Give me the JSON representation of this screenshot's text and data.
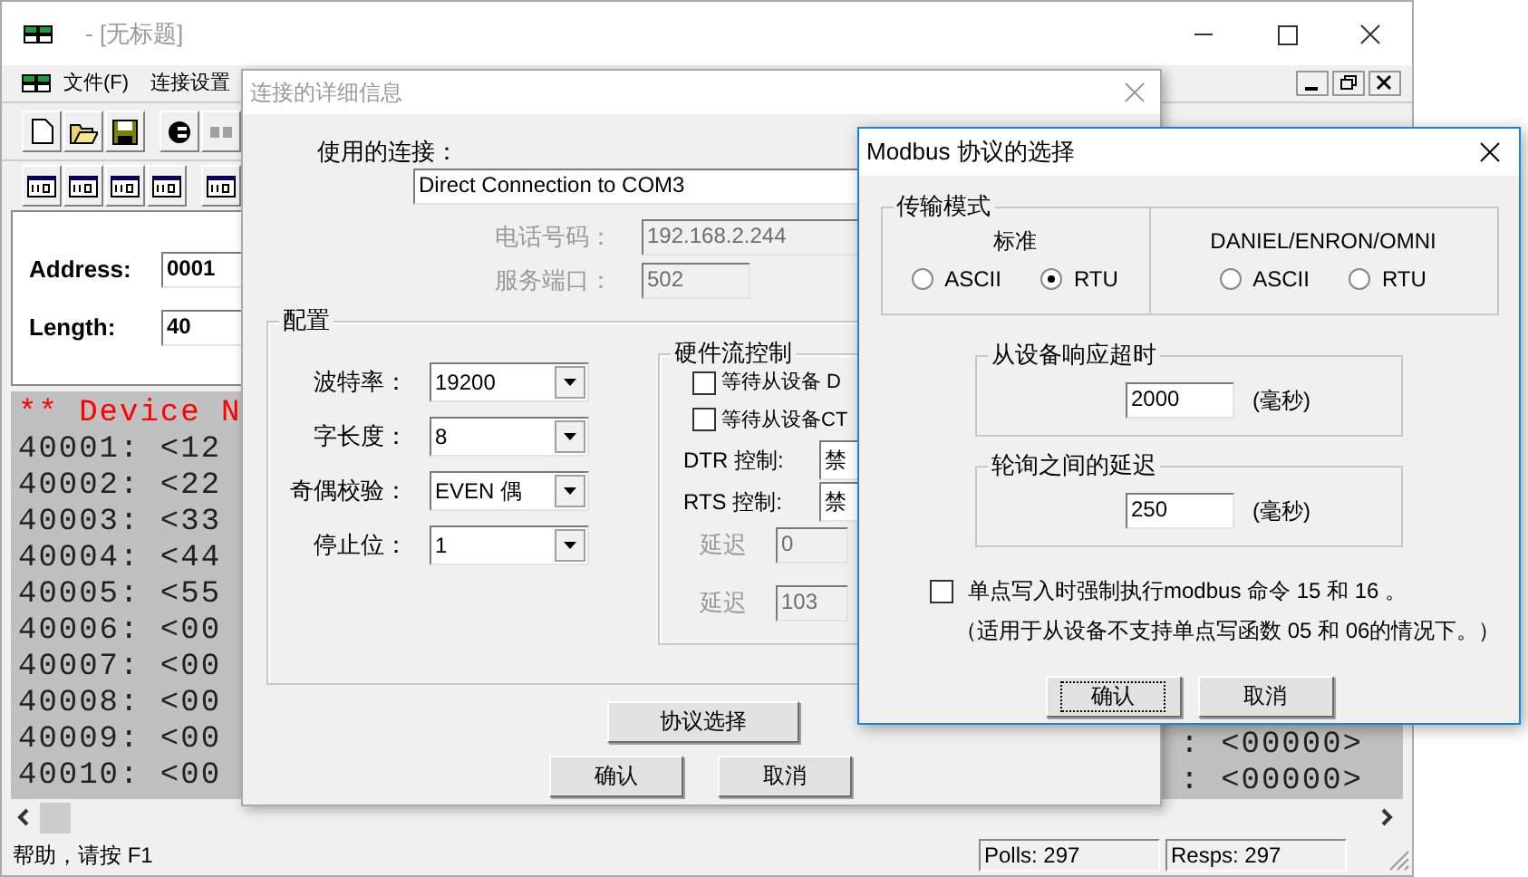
{
  "main_window": {
    "title": "- [无标题]",
    "menu": [
      "文件(F)",
      "连接设置"
    ],
    "address": {
      "label": "Address:",
      "value": "0001"
    },
    "length": {
      "label": "Length:",
      "value": "40"
    },
    "data_header": "** Device N",
    "data_rows": [
      "40001: <12",
      "40002: <22",
      "40003: <33",
      "40004: <44",
      "40005: <55",
      "40006: <00",
      "40007: <00",
      "40008: <00",
      "40009: <00",
      "40010: <00"
    ],
    "right_rows": [
      ": <00000>",
      ": <00000>"
    ],
    "status_bar": {
      "help": "帮助，请按 F1",
      "polls": "Polls: 297",
      "resps": "Resps: 297"
    }
  },
  "connection_dialog": {
    "title": "连接的详细信息",
    "connection": {
      "label": "使用的连接：",
      "value": "Direct Connection to COM3"
    },
    "phone": {
      "label": "电话号码：",
      "value": "192.168.2.244",
      "disabled": true
    },
    "port": {
      "label": "服务端口：",
      "value": "502",
      "disabled": true
    },
    "config": {
      "title": "配置",
      "fields": [
        {
          "label": "波特率：",
          "value": "19200"
        },
        {
          "label": "字长度：",
          "value": "8"
        },
        {
          "label": "奇偶校验：",
          "value": "EVEN 偶"
        },
        {
          "label": "停止位：",
          "value": "1"
        }
      ]
    },
    "flow_control": {
      "title": "硬件流控制",
      "checks": [
        {
          "label": "等待从设备 D",
          "checked": false
        },
        {
          "label": "等待从设备CT",
          "checked": false
        }
      ],
      "controls": [
        {
          "label": "DTR 控制:",
          "value": "禁"
        },
        {
          "label": "RTS 控制:",
          "value": "禁"
        }
      ],
      "delays": [
        {
          "label": "延迟",
          "value": "0",
          "disabled": true
        },
        {
          "label": "延迟",
          "value": "103",
          "disabled": true
        }
      ]
    },
    "protocol_button": "协议选择",
    "buttons": [
      "确认",
      "取消"
    ]
  },
  "modbus_dialog": {
    "title": "Modbus 协议的选择",
    "transmission": {
      "title": "传输模式",
      "modes": [
        {
          "title": "标准",
          "options": [
            {
              "label": "ASCII",
              "selected": false
            },
            {
              "label": "RTU",
              "selected": true
            }
          ]
        },
        {
          "title": "DANIEL/ENRON/OMNI",
          "options": [
            {
              "label": "ASCII",
              "selected": false
            },
            {
              "label": "RTU",
              "selected": false
            }
          ]
        }
      ]
    },
    "timeout": {
      "title": "从设备响应超时",
      "value": "2000",
      "unit": "(毫秒)"
    },
    "poll_delay": {
      "title": "轮询之间的延迟",
      "value": "250",
      "unit": "(毫秒)"
    },
    "force": {
      "checked": false,
      "label": "单点写入时强制执行modbus 命令 15 和 16 。",
      "note": "（适用于从设备不支持单点写函数 05 和 06的情况下。）"
    },
    "buttons": [
      {
        "label": "确认",
        "focused": true
      },
      {
        "label": "取消",
        "focused": false
      }
    ]
  }
}
